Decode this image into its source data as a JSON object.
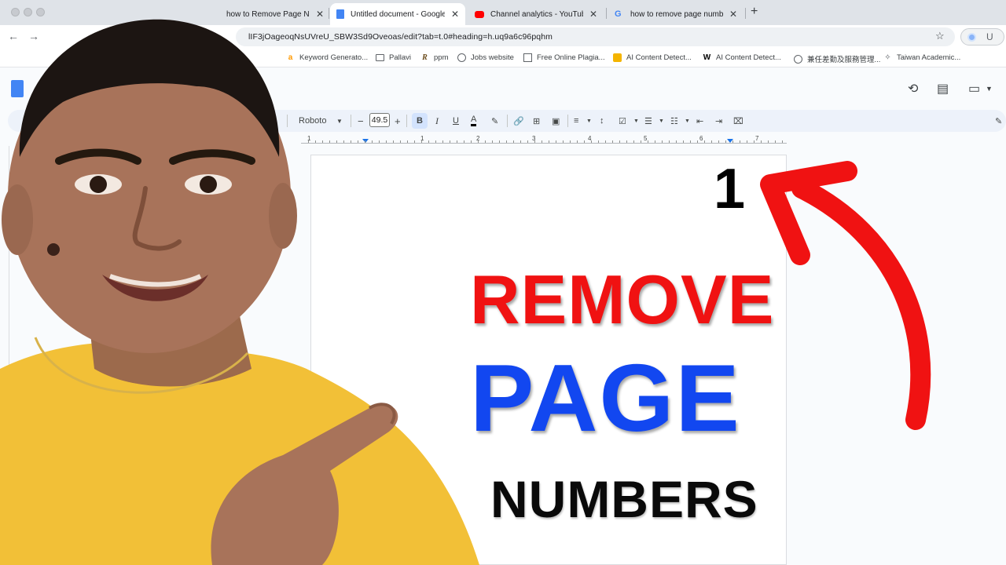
{
  "browser": {
    "tabs": [
      {
        "title": "how to Remove Page Nu",
        "favicon": "page-icon",
        "active": false
      },
      {
        "title": "Untitled document - Google D",
        "favicon": "docs-icon",
        "active": true
      },
      {
        "title": "Channel analytics - YouTube S",
        "favicon": "youtube-icon",
        "active": false
      },
      {
        "title": "how to remove page numbers",
        "favicon": "google-icon",
        "active": false
      }
    ],
    "new_tab": "+",
    "close": "✕",
    "url": "lIF3jOageoqNsUVreU_SBW3Sd9Oveoas/edit?tab=t.0#heading=h.uq9a6c96pqhm",
    "profile_letter": "U"
  },
  "bookmarks": [
    {
      "label": "Keyword Generato...",
      "icon": "a"
    },
    {
      "label": "Pallavi",
      "icon": "folder"
    },
    {
      "label": "ppm",
      "icon": "R"
    },
    {
      "label": "Jobs website",
      "icon": "globe"
    },
    {
      "label": "Free Online Plagia...",
      "icon": "doc"
    },
    {
      "label": "AI Content Detect...",
      "icon": "ai"
    },
    {
      "label": "AI Content Detect...",
      "icon": "W"
    },
    {
      "label": "兼任差勤及服務管理...",
      "icon": "globe"
    },
    {
      "label": "Taiwan Academic...",
      "icon": "ta"
    }
  ],
  "toolbar": {
    "font": "Roboto",
    "font_size": "49.5",
    "minus": "−",
    "plus": "+",
    "bold": "B",
    "italic": "I",
    "underline": "U",
    "text_color": "A"
  },
  "ruler_numbers": [
    "1",
    "1",
    "2",
    "3",
    "4",
    "5",
    "6",
    "7"
  ],
  "thumbnail": {
    "page_number": "1",
    "line1": "REMOVE",
    "line2": "PAGE",
    "line3": "NUMBERS"
  },
  "colors": {
    "accent_red": "#f01212",
    "accent_blue": "#1247f0",
    "toolbar_bg": "#edf2fa",
    "docs_blue": "#4285f4"
  }
}
